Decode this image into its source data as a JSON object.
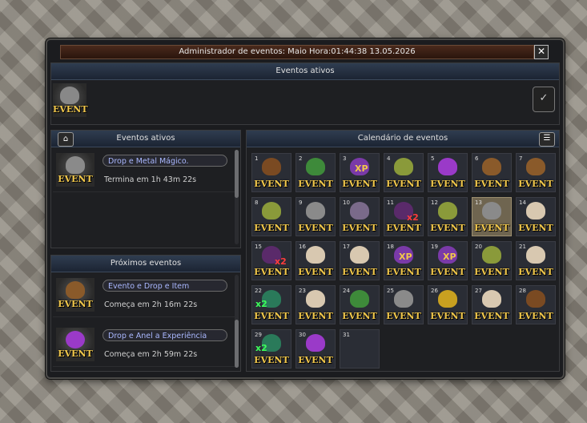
{
  "window": {
    "title": "Administrador de eventos: Maio Hora:01:44:38 13.05.2026",
    "menu_icon": "list-icon",
    "close_label": "✕"
  },
  "active_section": {
    "header": "Eventos ativos",
    "event_label": "EVENT",
    "confirm_icon": "check-icon"
  },
  "left_active": {
    "header": "Eventos ativos",
    "home_icon": "home-icon",
    "items": [
      {
        "name": "Drop e Metal Mágico.",
        "status": "Termina em 1h 43m 22s",
        "icon": "metal-icon",
        "label": "EVENT"
      }
    ]
  },
  "upcoming": {
    "header": "Próximos eventos",
    "items": [
      {
        "name": "Evento e Drop e Item",
        "status": "Começa em 2h 16m 22s",
        "icon": "wood-icon",
        "label": "EVENT"
      },
      {
        "name": "Drop e Anel a Experiência",
        "status": "Começa em 2h 59m 22s",
        "icon": "ring-icon",
        "label": "EVENT"
      }
    ]
  },
  "calendar": {
    "header": "Calendário de eventos",
    "filter_icon": "filter-icon",
    "today": 13,
    "days": [
      {
        "day": "1",
        "icon": "chest",
        "label": "EVENT"
      },
      {
        "day": "2",
        "icon": "green-hand",
        "label": "EVENT"
      },
      {
        "day": "3",
        "icon": "xp",
        "label": "EVENT",
        "badge": "XP"
      },
      {
        "day": "4",
        "icon": "feather",
        "label": "EVENT"
      },
      {
        "day": "5",
        "icon": "ring",
        "label": "EVENT"
      },
      {
        "day": "6",
        "icon": "wood",
        "label": "EVENT"
      },
      {
        "day": "7",
        "icon": "wood",
        "label": "EVENT"
      },
      {
        "day": "8",
        "icon": "feather",
        "label": "EVENT"
      },
      {
        "day": "9",
        "icon": "metal",
        "label": "EVENT"
      },
      {
        "day": "10",
        "icon": "scroll",
        "label": "EVENT"
      },
      {
        "day": "11",
        "icon": "purple-x2",
        "label": "EVENT",
        "badge": "x2"
      },
      {
        "day": "12",
        "icon": "feather",
        "label": "EVENT"
      },
      {
        "day": "13",
        "icon": "metal",
        "label": "EVENT"
      },
      {
        "day": "14",
        "icon": "pyramid",
        "label": "EVENT"
      },
      {
        "day": "15",
        "icon": "purple-x2",
        "label": "EVENT",
        "badge": "x2"
      },
      {
        "day": "16",
        "icon": "pyramid",
        "label": "EVENT"
      },
      {
        "day": "17",
        "icon": "pyramid",
        "label": "EVENT"
      },
      {
        "day": "18",
        "icon": "xp",
        "label": "EVENT",
        "badge": "XP"
      },
      {
        "day": "19",
        "icon": "xp",
        "label": "EVENT",
        "badge": "XP"
      },
      {
        "day": "20",
        "icon": "feather",
        "label": "EVENT"
      },
      {
        "day": "21",
        "icon": "pyramid",
        "label": "EVENT"
      },
      {
        "day": "22",
        "icon": "green-x2",
        "label": "EVENT",
        "badge": "x2"
      },
      {
        "day": "23",
        "icon": "pyramid",
        "label": "EVENT"
      },
      {
        "day": "24",
        "icon": "green-hand",
        "label": "EVENT"
      },
      {
        "day": "25",
        "icon": "metal",
        "label": "EVENT"
      },
      {
        "day": "26",
        "icon": "coins",
        "label": "EVENT"
      },
      {
        "day": "27",
        "icon": "pyramid",
        "label": "EVENT"
      },
      {
        "day": "28",
        "icon": "chest",
        "label": "EVENT"
      },
      {
        "day": "29",
        "icon": "green-x2",
        "label": "EVENT",
        "badge": "x2"
      },
      {
        "day": "30",
        "icon": "ring",
        "label": "EVENT"
      },
      {
        "day": "31",
        "icon": "",
        "label": ""
      }
    ]
  },
  "icon_colors": {
    "chest": "#7a4a22",
    "green-hand": "#3e8a3a",
    "xp": "#7a3aa8",
    "feather": "#8a9a3a",
    "ring": "#9a3ac8",
    "wood": "#8a5a2a",
    "metal": "#8a8a8a",
    "scroll": "#7a6a8a",
    "purple-x2": "#5a2a6a",
    "pyramid": "#d8c8b0",
    "green-x2": "#2a7a5a",
    "coins": "#c8a020"
  }
}
